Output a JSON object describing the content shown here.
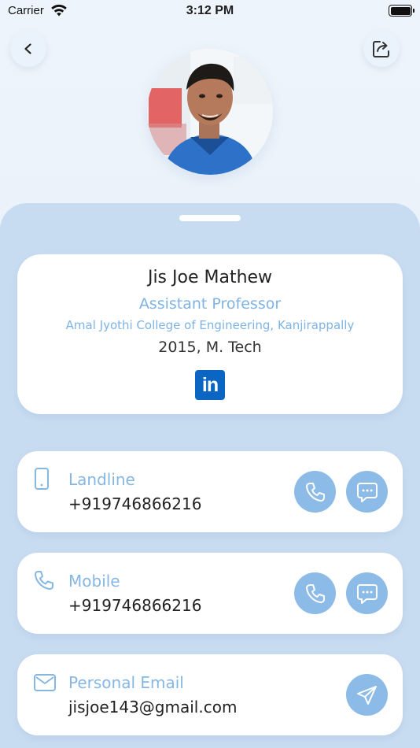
{
  "status_bar": {
    "carrier": "Carrier",
    "time": "3:12 PM"
  },
  "profile": {
    "name": "Jis Joe Mathew",
    "designation": "Assistant Professor",
    "institution": "Amal Jyothi College of Engineering, Kanjirappally",
    "batch": "2015, M. Tech",
    "linkedin_label": "in"
  },
  "contacts": [
    {
      "label": "Landline",
      "value": "+919746866216"
    },
    {
      "label": "Mobile",
      "value": "+919746866216"
    },
    {
      "label": "Personal Email",
      "value": "jisjoe143@gmail.com"
    }
  ],
  "colors": {
    "accent": "#86b7e3",
    "action_button": "#8cbbe7",
    "sheet": "#c8dcf1",
    "linkedin": "#0a66c2"
  },
  "icons": [
    "back-icon",
    "share-icon",
    "wifi-icon",
    "battery-icon",
    "phone-device-icon",
    "phone-icon",
    "chat-icon",
    "mail-icon",
    "send-icon",
    "linkedin-icon"
  ]
}
